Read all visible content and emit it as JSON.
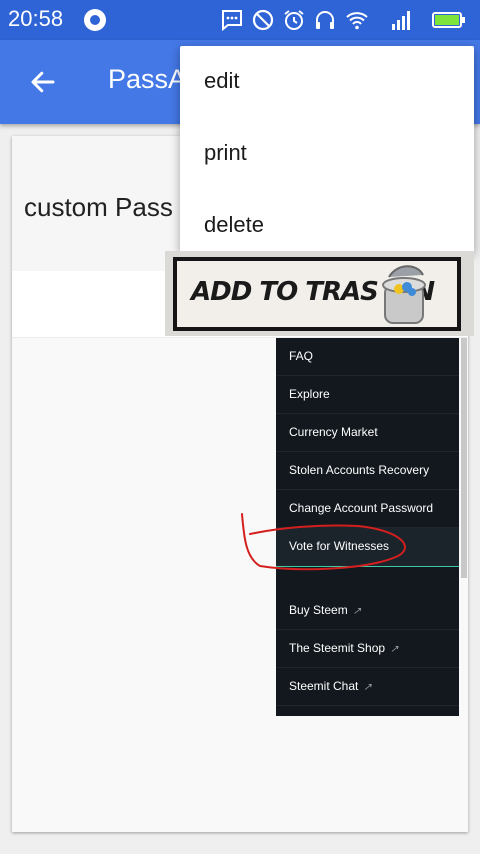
{
  "status_bar": {
    "time": "20:58",
    "icons": [
      "record-icon",
      "message-icon",
      "do-not-disturb-icon",
      "alarm-icon",
      "headset-icon",
      "wifi-icon",
      "signal-icon",
      "battery-charging-icon"
    ]
  },
  "app_bar": {
    "title": "PassA"
  },
  "card": {
    "row1_label": "custom Pass"
  },
  "menu": {
    "items": [
      {
        "label": "edit"
      },
      {
        "label": "print"
      },
      {
        "label": "delete"
      }
    ]
  },
  "sticker": {
    "text": "ADD TO TRAS BIN",
    "icon": "trash-bin-icon"
  },
  "steemit_menu": {
    "items": [
      {
        "label": "FAQ"
      },
      {
        "label": "Explore"
      },
      {
        "label": "Currency Market"
      },
      {
        "label": "Stolen Accounts Recovery"
      },
      {
        "label": "Change Account Password"
      },
      {
        "label": "Vote for Witnesses"
      },
      {
        "label": ""
      },
      {
        "label": "Buy Steem"
      },
      {
        "label": "The Steemit Shop"
      },
      {
        "label": "Steemit Chat"
      }
    ],
    "external_link_icon": "external-link-icon",
    "accent_color": "#3ec7a3"
  },
  "colors": {
    "status_bar": "#2f64d6",
    "app_bar": "#4478e6",
    "annotation": "#d41f1f"
  }
}
